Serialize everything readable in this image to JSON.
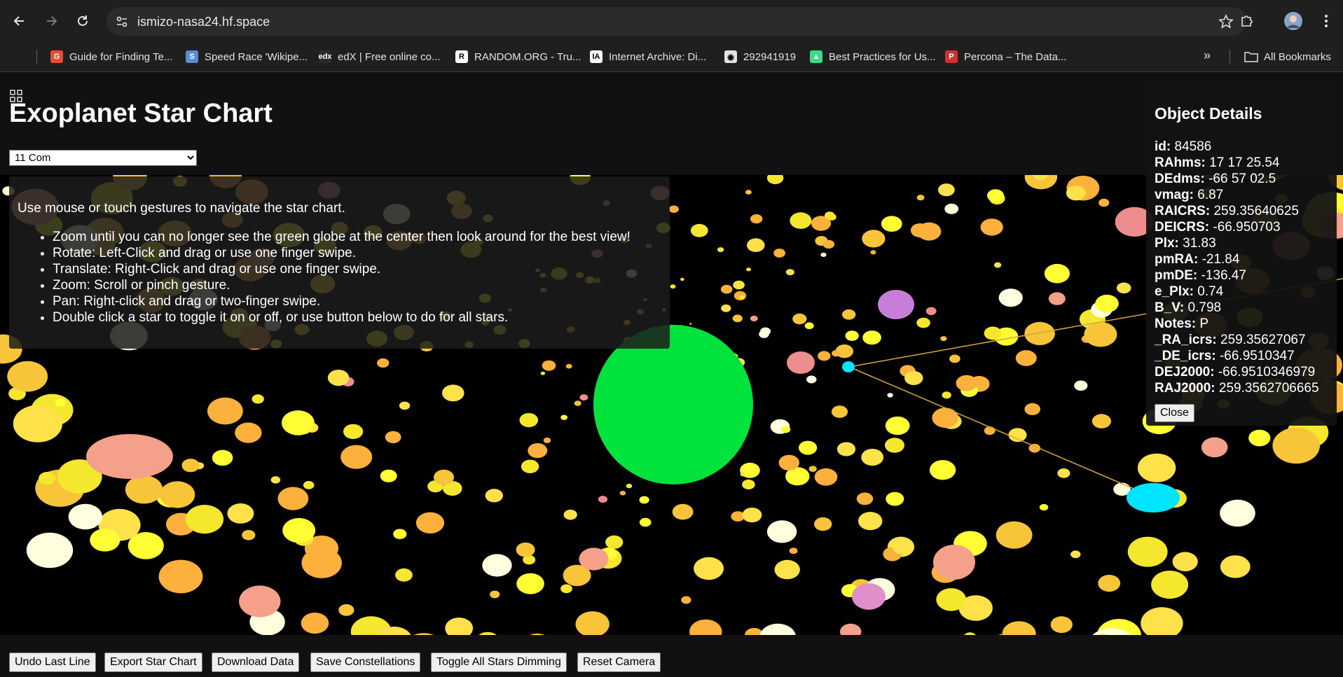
{
  "browser": {
    "url": "ismizo-nasa24.hf.space",
    "bookmarks": [
      {
        "label": "Guide for Finding Te...",
        "color": "#e94e32",
        "glyph": "G"
      },
      {
        "label": "Speed Race 'Wikipe...",
        "color": "#5b8bd0",
        "glyph": "S"
      },
      {
        "label": "edX | Free online co...",
        "color": "#2b2b2b",
        "glyph": "edx"
      },
      {
        "label": "RANDOM.ORG - Tru...",
        "color": "#ffffff",
        "glyph": "R"
      },
      {
        "label": "Internet Archive: Di...",
        "color": "#ffffff",
        "glyph": "IA"
      },
      {
        "label": "292941919",
        "color": "#e3e3e3",
        "glyph": "◉"
      },
      {
        "label": "Best Practices for Us...",
        "color": "#3ddc84",
        "glyph": "▲"
      },
      {
        "label": "Percona – The Data...",
        "color": "#d0312d",
        "glyph": "P"
      }
    ],
    "all_bookmarks": "All Bookmarks"
  },
  "page": {
    "title": "Exoplanet Star Chart",
    "selected_star": "11 Com"
  },
  "instructions": {
    "intro": "Use mouse or touch gestures to navigate the star chart.",
    "items": [
      "Zoom until you can no longer see the green globe at the center then look around for the best view!",
      "Rotate: Left-Click and drag or use one finger swipe.",
      "Translate: Right-Click and drag or use one finger swipe.",
      "Zoom: Scroll or pinch gesture.",
      "Pan: Right-click and drag or two-finger swipe.",
      "Double click a star to toggle it on or off, or use button below to do for all stars."
    ]
  },
  "details": {
    "title": "Object Details",
    "fields": [
      {
        "key": "id:",
        "value": "84586"
      },
      {
        "key": "RAhms:",
        "value": "17 17 25.54"
      },
      {
        "key": "DEdms:",
        "value": "-66 57 02.5"
      },
      {
        "key": "vmag:",
        "value": "6.87"
      },
      {
        "key": "RAICRS:",
        "value": "259.35640625"
      },
      {
        "key": "DEICRS:",
        "value": "-66.950703"
      },
      {
        "key": "Plx:",
        "value": "31.83"
      },
      {
        "key": "pmRA:",
        "value": "-21.84"
      },
      {
        "key": "pmDE:",
        "value": "-136.47"
      },
      {
        "key": "e_Plx:",
        "value": "0.74"
      },
      {
        "key": "B_V:",
        "value": "0.798"
      },
      {
        "key": "Notes:",
        "value": "P"
      },
      {
        "key": "_RA_icrs:",
        "value": "259.3562706​7"
      },
      {
        "key": "_DE_icrs:",
        "value": "-66.9510347"
      },
      {
        "key": "DEJ2000:",
        "value": "-66.9510346979"
      },
      {
        "key": "RAJ2000:",
        "value": "259.3562706665"
      }
    ],
    "close_label": "Close"
  },
  "footer": {
    "undo": "Undo Last Line",
    "export": "Export Star Chart",
    "download": "Download Data",
    "save": "Save Constellations",
    "toggle": "Toggle All Stars Dimming",
    "reset": "Reset Camera"
  },
  "colors": {
    "globe": "#00e33d",
    "selected_star": "#00e5ff",
    "constellation_line": "#d6a83a",
    "star_palette": [
      "#ffff33",
      "#f5e62e",
      "#ffe14a",
      "#f7c43a",
      "#fbb13c",
      "#ffffe0",
      "#f4a08a",
      "#ee8d8d",
      "#c77ed9",
      "#e08fc9"
    ]
  }
}
